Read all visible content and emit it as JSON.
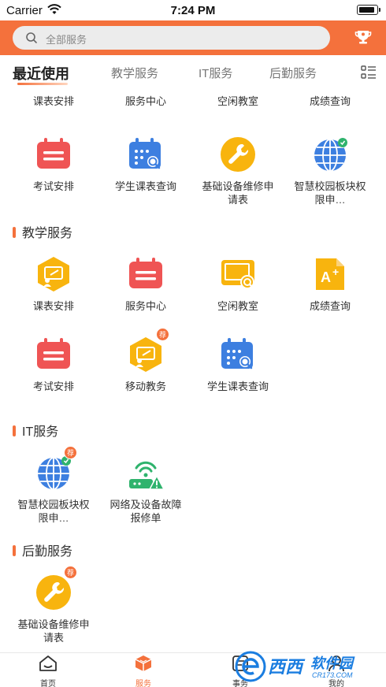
{
  "status_bar": {
    "carrier": "Carrier",
    "time": "7:24 PM"
  },
  "search": {
    "placeholder": "全部服务"
  },
  "tabs": [
    {
      "label": "最近使用",
      "active": true
    },
    {
      "label": "教学服务",
      "active": false
    },
    {
      "label": "IT服务",
      "active": false
    },
    {
      "label": "后勤服务",
      "active": false
    }
  ],
  "recent": {
    "top_row_labels": [
      "课表安排",
      "服务中心",
      "空闲教室",
      "成绩查询"
    ],
    "items": [
      {
        "label": "考试安排",
        "icon": "calendar-icon"
      },
      {
        "label": "学生课表查询",
        "icon": "calendar-search-icon"
      },
      {
        "label": "基础设备维修申请表",
        "icon": "wrench-icon"
      },
      {
        "label": "智慧校园板块权限申…",
        "icon": "globe-icon"
      }
    ]
  },
  "teaching": {
    "title": "教学服务",
    "items": [
      {
        "label": "课表安排",
        "icon": "teacher-board-icon",
        "badge": ""
      },
      {
        "label": "服务中心",
        "icon": "calendar-icon",
        "badge": ""
      },
      {
        "label": "空闲教室",
        "icon": "classroom-search-icon",
        "badge": ""
      },
      {
        "label": "成绩查询",
        "icon": "grade-doc-icon",
        "badge": ""
      },
      {
        "label": "考试安排",
        "icon": "calendar-icon",
        "badge": ""
      },
      {
        "label": "移动教务",
        "icon": "teacher-board-icon",
        "badge": "荐"
      },
      {
        "label": "学生课表查询",
        "icon": "calendar-search-icon",
        "badge": ""
      }
    ]
  },
  "it": {
    "title": "IT服务",
    "items": [
      {
        "label": "智慧校园板块权限申…",
        "icon": "globe-icon",
        "badge": "荐"
      },
      {
        "label": "网络及设备故障报修单",
        "icon": "router-warning-icon",
        "badge": ""
      }
    ]
  },
  "logistics": {
    "title": "后勤服务",
    "items": [
      {
        "label": "基础设备维修申请表",
        "icon": "wrench-icon",
        "badge": "荐"
      }
    ]
  },
  "bottom_nav": [
    {
      "label": "首页",
      "icon": "home-icon",
      "active": false
    },
    {
      "label": "服务",
      "icon": "cube-icon",
      "active": true
    },
    {
      "label": "事务",
      "icon": "task-icon",
      "active": false
    },
    {
      "label": "我的",
      "icon": "profile-icon",
      "active": false
    }
  ],
  "watermark": {
    "text1": "西西",
    "text2": "软件园",
    "url": "CR173.COM"
  },
  "colors": {
    "accent": "#f4713c",
    "red": "#ef5454",
    "blue": "#3d7fe0",
    "yellow": "#f8b40e"
  }
}
